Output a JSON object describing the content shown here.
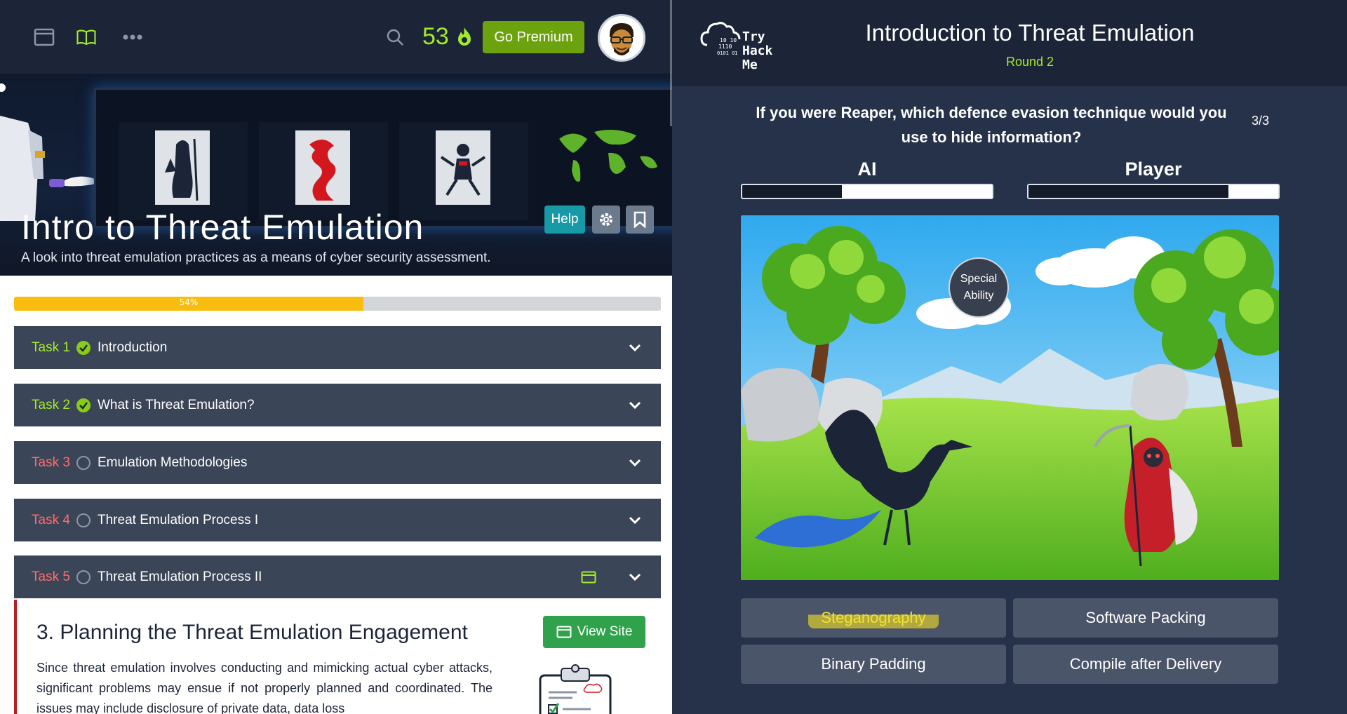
{
  "topbar": {
    "streak_count": "53",
    "premium_label": "Go Premium"
  },
  "hero": {
    "title": "Intro to Threat Emulation",
    "subtitle": "A look into threat emulation practices as a means of cyber security assessment.",
    "help_label": "Help"
  },
  "progress": {
    "percent": 54,
    "label": "54%"
  },
  "tasks": [
    {
      "num": "Task 1",
      "title": "Introduction",
      "status": "done"
    },
    {
      "num": "Task 2",
      "title": "What is Threat Emulation?",
      "status": "done"
    },
    {
      "num": "Task 3",
      "title": "Emulation Methodologies",
      "status": "todo"
    },
    {
      "num": "Task 4",
      "title": "Threat Emulation Process I",
      "status": "todo"
    },
    {
      "num": "Task 5",
      "title": "Threat Emulation Process II",
      "status": "todo"
    }
  ],
  "task_body": {
    "section_title": "3. Planning the Threat Emulation Engagement",
    "view_site_label": "View Site",
    "text": "Since threat emulation involves conducting and mimicking actual cyber attacks, significant problems may ensue if not properly planned and coordinated. The issues may include disclosure of private data, data loss"
  },
  "game": {
    "logo_text": "Try Hack Me",
    "title": "Introduction to Threat Emulation",
    "round": "Round 2",
    "question": "If you were Reaper, which defence evasion technique would you use to hide information?",
    "question_count": "3/3",
    "ai_label": "AI",
    "player_label": "Player",
    "ai_health": 0.4,
    "player_health": 0.8,
    "special_ability": "Special Ability",
    "answers": [
      "Steganography",
      "Software Packing",
      "Binary Padding",
      "Compile after Delivery"
    ]
  },
  "colors": {
    "accent_green": "#a3ea2a",
    "progress_yellow": "#f9bd0f",
    "task_bg": "#3b4558",
    "answer_highlight": "#f2e233"
  }
}
